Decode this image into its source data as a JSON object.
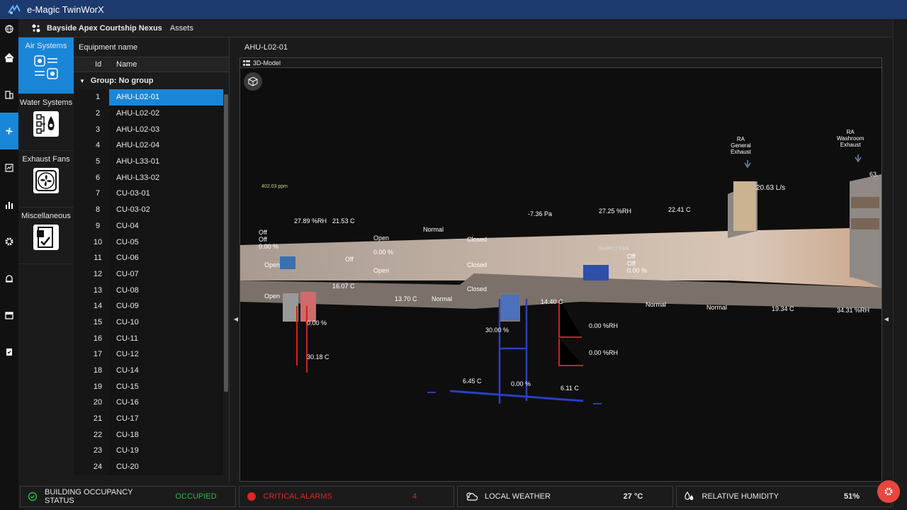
{
  "app": {
    "title": "e-Magic TwinWorX"
  },
  "header": {
    "site": "Bayside Apex Courtship Nexus",
    "section": "Assets"
  },
  "nav_icons": [
    "globe-icon",
    "home-icon",
    "building-icon",
    "fan-icon",
    "report-icon",
    "bar-chart-icon",
    "gear-icon",
    "alarm-icon",
    "calendar-icon",
    "checklist-icon"
  ],
  "categories": [
    {
      "label": "Air Systems",
      "icon": "air-systems-icon",
      "active": true
    },
    {
      "label": "Water Systems",
      "icon": "water-systems-icon",
      "active": false
    },
    {
      "label": "Exhaust Fans",
      "icon": "exhaust-fan-icon",
      "active": false
    },
    {
      "label": "Miscellaneous",
      "icon": "misc-icon",
      "active": false
    }
  ],
  "equipment": {
    "heading": "Equipment name",
    "col_id": "Id",
    "col_name": "Name",
    "group": "Group: No group",
    "rows": [
      {
        "id": "1",
        "name": "AHU-L02-01"
      },
      {
        "id": "2",
        "name": "AHU-L02-02"
      },
      {
        "id": "3",
        "name": "AHU-L02-03"
      },
      {
        "id": "4",
        "name": "AHU-L02-04"
      },
      {
        "id": "5",
        "name": "AHU-L33-01"
      },
      {
        "id": "6",
        "name": "AHU-L33-02"
      },
      {
        "id": "7",
        "name": "CU-03-01"
      },
      {
        "id": "8",
        "name": "CU-03-02"
      },
      {
        "id": "9",
        "name": "CU-04"
      },
      {
        "id": "10",
        "name": "CU-05"
      },
      {
        "id": "11",
        "name": "CU-06"
      },
      {
        "id": "12",
        "name": "CU-07"
      },
      {
        "id": "13",
        "name": "CU-08"
      },
      {
        "id": "14",
        "name": "CU-09"
      },
      {
        "id": "15",
        "name": "CU-10"
      },
      {
        "id": "16",
        "name": "CU-11"
      },
      {
        "id": "17",
        "name": "CU-12"
      },
      {
        "id": "18",
        "name": "CU-14"
      },
      {
        "id": "19",
        "name": "CU-15"
      },
      {
        "id": "20",
        "name": "CU-16"
      },
      {
        "id": "21",
        "name": "CU-17"
      },
      {
        "id": "22",
        "name": "CU-18"
      },
      {
        "id": "23",
        "name": "CU-19"
      },
      {
        "id": "24",
        "name": "CU-20"
      }
    ],
    "selected": "1"
  },
  "main": {
    "title": "AHU-L02-01",
    "tab": "3D-Model"
  },
  "model": {
    "ra_general": "RA\nGeneral\nExhaust",
    "ra_washroom": "RA\nWashroom\nExhaust",
    "gea_flow": "20.63 L/s",
    "co2": "402.03 ppm",
    "ea_h": "27.89 %RH",
    "ea_t": "21.53 C",
    "ea_dp_s": "Normal",
    "ea_p": "-7.36 Pa",
    "ea_h2": "27.25 %RH",
    "ea_t2": "22.41 C",
    "ef_state_s": "Off",
    "ef_state_c": "Off",
    "ef_output": "0.00 %",
    "damper1": "Open",
    "damper2": "Open",
    "damper3": "Open",
    "hrwf_s": "Open",
    "hrwf_pct": "0.00 %",
    "hrwf_c": "Open",
    "hrw_s": "Off",
    "eaod_s": "Closed",
    "eaod_c": "Closed",
    "rcd_c": "Closed",
    "supply_fan": "SUPPLY FAN",
    "sf_s": "Off",
    "sf_c": "Off",
    "sf_o": "0.00 %",
    "rc_t": "16.07 C",
    "hr_t": "13.70 C",
    "ll_a": "Normal",
    "rc_t2": "14.40 C",
    "dap_a": "Normal",
    "ht_a": "Normal",
    "da_t": "19.34 C",
    "da_h": "34.31 %RH",
    "pcv_pct": "0.00 %",
    "pcv_t": "30.18 C",
    "ccv_pct": "30.00 %",
    "hum1": "0.00 %RH",
    "hum2": "0.00 %RH",
    "cs_t": "6.45 C",
    "chwv": "0.00 %",
    "cr_t": "6.11 C",
    "wra": "63."
  },
  "status": [
    {
      "label": "BUILDING OCCUPANCY STATUS",
      "value": "OCCUPIED",
      "icon": "check-circle-icon",
      "color": "#2fb344"
    },
    {
      "label": "CRITICAL ALARMS",
      "value": "4",
      "icon": "red-dot-icon",
      "color": "#e02424"
    },
    {
      "label": "LOCAL WEATHER",
      "value": "27 °C",
      "icon": "cloud-sun-icon",
      "color": "#ffffff"
    },
    {
      "label": "RELATIVE HUMIDITY",
      "value": "51%",
      "icon": "humidity-icon",
      "color": "#ffffff"
    }
  ]
}
